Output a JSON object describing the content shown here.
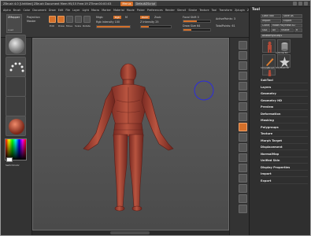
{
  "window": {
    "title": "ZBrush  4.0 [Untitled]    ZBrush Document    Mem:95/15  Free:19  ZTime:00:00:03",
    "menus_btn": "Menus",
    "default_script": "DefaultZScript"
  },
  "menubar": [
    "Alpha",
    "Brush",
    "Color",
    "Document",
    "Draw",
    "Edit",
    "File",
    "Layer",
    "Light",
    "Macro",
    "Marker",
    "Material",
    "Movie",
    "Picker",
    "Preferences",
    "Render",
    "Stencil",
    "Stroke",
    "Texture",
    "Tool",
    "Transform",
    "Zplugin",
    "Zscript"
  ],
  "toolbar": {
    "tool_label": "ZMapper",
    "tool_sub": "Load",
    "projection": "Projection",
    "master": "Master",
    "edit": "Edit",
    "draw": "Draw",
    "move": "Move",
    "scale": "Scale",
    "rotate": "Rotate",
    "mrgb": "Mrgb",
    "rgb": "Rgb",
    "m": "M",
    "rgb_intensity": "Rgb Intensity 100",
    "zadd": "Zadd",
    "zsub": "Zsub",
    "z_intensity": "Z Intensity 25",
    "focal_shift": "Focal Shift 0",
    "draw_size": "Draw Size 64",
    "active_points": "ActivePoints: 3",
    "total_points": "TotalPoints: 61"
  },
  "left_shelf": {
    "switch_color": "SwitchColor"
  },
  "tool_panel": {
    "title": "Tool",
    "buttons": [
      "Load Tool",
      "Save As",
      "Import",
      "Export",
      "Clone",
      "Make PolyMesh3D",
      "GoZ",
      "All",
      "Visible",
      "R"
    ],
    "thumb_labels": [
      "AnatomyStudy1",
      "Cylinder3D",
      "SimpleBrush",
      "PolyMesh3D"
    ],
    "sections": [
      "SubTool",
      "Layers",
      "Geometry",
      "Geometry HD",
      "Preview",
      "Deformation",
      "Masking",
      "Polygroups",
      "Texture",
      "Morph Target",
      "Displacement",
      "NormalMap",
      "Unified Skin",
      "Display Properties",
      "Import",
      "Export"
    ]
  },
  "colors": {
    "accent": "#d4702a",
    "model": "#a5463a",
    "gizmo": "#2c2cdd",
    "canvas": "#585858"
  }
}
